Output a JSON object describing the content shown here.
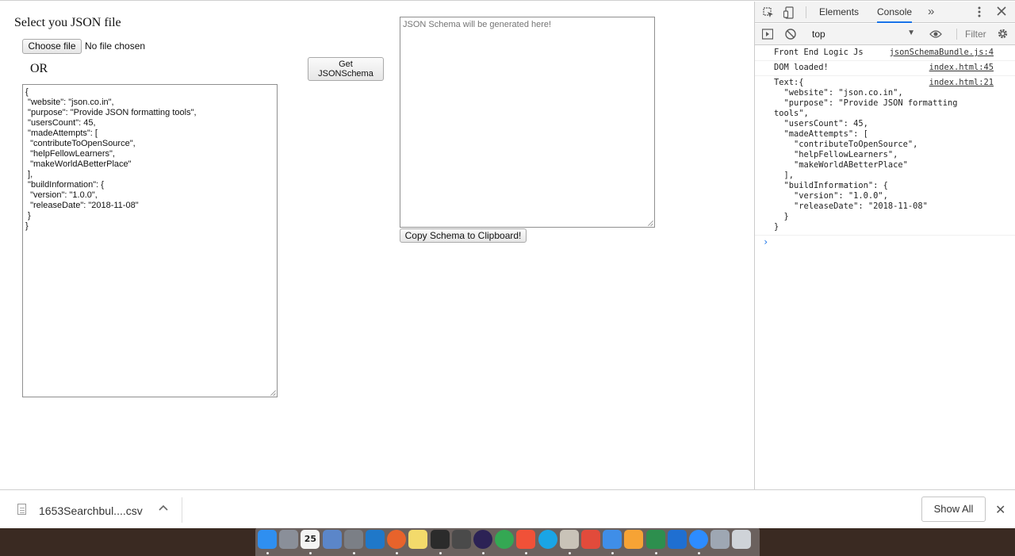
{
  "page": {
    "heading": "Select you JSON file",
    "choose_file_label": "Choose file",
    "no_file_text": "No file chosen",
    "or_text": "OR",
    "get_schema_line1": "Get",
    "get_schema_line2": "JSONSchema",
    "json_input_value": "{\n \"website\": \"json.co.in\",\n \"purpose\": \"Provide JSON formatting tools\",\n \"usersCount\": 45,\n \"madeAttempts\": [\n  \"contributeToOpenSource\",\n  \"helpFellowLearners\",\n  \"makeWorldABetterPlace\"\n ],\n \"buildInformation\": {\n  \"version\": \"1.0.0\",\n  \"releaseDate\": \"2018-11-08\"\n }\n}",
    "schema_placeholder": "JSON Schema will be generated here!",
    "copy_schema_label": "Copy Schema to Clipboard!"
  },
  "devtools": {
    "tabs": [
      "Elements",
      "Console"
    ],
    "active_tab": "Console",
    "more_tabs": "»",
    "context": "top",
    "filter_placeholder": "Filter",
    "console": [
      {
        "message": "Front End Logic Js",
        "source": "jsonSchemaBundle.js:4"
      },
      {
        "message": "DOM loaded!",
        "source": "index.html:45"
      },
      {
        "message": "Text:{\n  \"website\": \"json.co.in\",\n  \"purpose\": \"Provide JSON formatting tools\",\n  \"usersCount\": 45,\n  \"madeAttempts\": [\n    \"contributeToOpenSource\",\n    \"helpFellowLearners\",\n    \"makeWorldABetterPlace\"\n  ],\n  \"buildInformation\": {\n    \"version\": \"1.0.0\",\n    \"releaseDate\": \"2018-11-08\"\n  }\n}",
        "source": "index.html:21"
      }
    ],
    "prompt_symbol": "›"
  },
  "download_shelf": {
    "file_name": "1653Searchbul....csv",
    "show_all_label": "Show All",
    "close_symbol": "✕"
  },
  "dock": {
    "calendar_day": "25",
    "icons": [
      {
        "name": "finder-icon",
        "color": "#2f8ff0"
      },
      {
        "name": "launchpad-icon",
        "color": "#8a8f99"
      },
      {
        "name": "calendar-icon",
        "color": "#f4f4f4"
      },
      {
        "name": "preview-icon",
        "color": "#5b86c9"
      },
      {
        "name": "system-preferences-icon",
        "color": "#7b7f86"
      },
      {
        "name": "vscode-icon",
        "color": "#1f78c9"
      },
      {
        "name": "firefox-icon",
        "color": "#e8632b"
      },
      {
        "name": "notes-icon",
        "color": "#f3da6b"
      },
      {
        "name": "terminal-icon",
        "color": "#2b2b2b"
      },
      {
        "name": "sublime-icon",
        "color": "#4a4a4a"
      },
      {
        "name": "eclipse-icon",
        "color": "#2c2255"
      },
      {
        "name": "chrome-icon",
        "color": "#34a853"
      },
      {
        "name": "swift-icon",
        "color": "#f05138"
      },
      {
        "name": "skype-icon",
        "color": "#1aa5e6"
      },
      {
        "name": "books-icon",
        "color": "#c9c3b8"
      },
      {
        "name": "sketch-icon",
        "color": "#e24b3b"
      },
      {
        "name": "xcode-icon",
        "color": "#3f8ee8"
      },
      {
        "name": "git-icon",
        "color": "#f6a335"
      },
      {
        "name": "sourcetree-icon",
        "color": "#2d8f4e"
      },
      {
        "name": "skype-business-icon",
        "color": "#1f6fd1"
      },
      {
        "name": "zoom-icon",
        "color": "#2d8cff"
      },
      {
        "name": "image-capture-icon",
        "color": "#9ea7b3"
      },
      {
        "name": "trash-icon",
        "color": "#cfd3d8"
      }
    ]
  }
}
